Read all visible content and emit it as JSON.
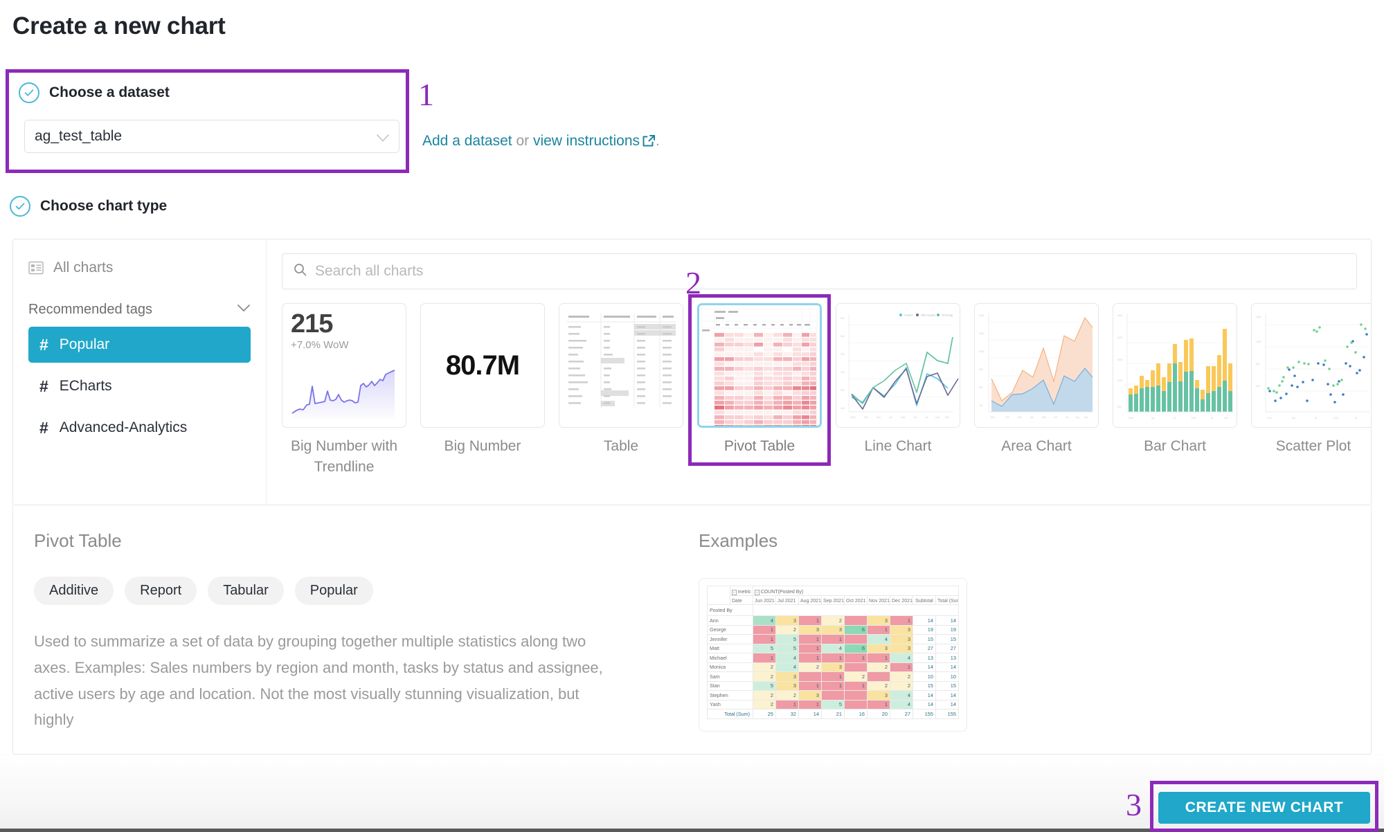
{
  "page_title": "Create a new chart",
  "colors": {
    "accent_teal": "#20A7C9",
    "annotation_purple": "#8C2AB8",
    "link_blue": "#1A85A0"
  },
  "annotations": {
    "one": "1",
    "two": "2",
    "three": "3"
  },
  "step_dataset": {
    "label": "Choose a dataset",
    "selected_value": "ag_test_table",
    "links": {
      "add": "Add a dataset",
      "or": " or ",
      "view": "view instructions",
      "period": "."
    }
  },
  "step_chart_type": {
    "label": "Choose chart type"
  },
  "sidebar": {
    "all_charts": "All charts",
    "recommended_tags": "Recommended tags",
    "tags": [
      {
        "label": "Popular",
        "active": true
      },
      {
        "label": "ECharts",
        "active": false
      },
      {
        "label": "Advanced-Analytics",
        "active": false
      }
    ]
  },
  "search": {
    "placeholder": "Search all charts"
  },
  "thumbnails": [
    {
      "name": "Big Number with Trendline",
      "kind": "bignumber-trend",
      "value": "215",
      "subtitle": "+7.0% WoW",
      "selected": false
    },
    {
      "name": "Big Number",
      "kind": "bignumber",
      "value": "80.7M",
      "selected": false
    },
    {
      "name": "Table",
      "kind": "table",
      "selected": false
    },
    {
      "name": "Pivot Table",
      "kind": "pivot",
      "selected": true
    },
    {
      "name": "Line Chart",
      "kind": "line",
      "selected": false
    },
    {
      "name": "Area Chart",
      "kind": "area",
      "selected": false
    },
    {
      "name": "Bar Chart",
      "kind": "bar",
      "selected": false
    },
    {
      "name": "Scatter Plot",
      "kind": "scatter",
      "selected": false
    }
  ],
  "detail": {
    "title": "Pivot Table",
    "tags": [
      "Additive",
      "Report",
      "Tabular",
      "Popular"
    ],
    "description": "Used to summarize a set of data by grouping together multiple statistics along two axes. Examples: Sales numbers by region and month, tasks by status and assignee, active users by age and location. Not the most visually stunning visualization, but highly",
    "examples_title": "Examples"
  },
  "example_pivot": {
    "metric_label": "metric",
    "count_label": "COUNT(Posted By)",
    "date_label": "Date",
    "row_header": "Posted By",
    "columns": [
      "Jun 2021",
      "Jul 2021",
      "Aug 2021",
      "Sep 2021",
      "Oct 2021",
      "Nov 2021",
      "Dec 2021"
    ],
    "subtotal_label": "Subtotal",
    "total_label": "Total (Sum)",
    "total_row_label": "Total (Sum)",
    "rows": [
      {
        "name": "Ann",
        "values": [
          "4",
          "3",
          "1",
          "2",
          "",
          "3",
          "1"
        ],
        "colors": [
          "g",
          "y",
          "r",
          "ly",
          "r",
          "y",
          "r"
        ],
        "subtotal": "14",
        "total": "14"
      },
      {
        "name": "George",
        "values": [
          "1",
          "2",
          "3",
          "3",
          "6",
          "1",
          "3"
        ],
        "colors": [
          "r",
          "ly",
          "y",
          "y",
          "dg",
          "r",
          "y"
        ],
        "subtotal": "19",
        "total": "19"
      },
      {
        "name": "Jennifer",
        "values": [
          "1",
          "5",
          "1",
          "1",
          "",
          "4",
          "3"
        ],
        "colors": [
          "r",
          "lg",
          "r",
          "r",
          "r",
          "lg",
          "y"
        ],
        "subtotal": "15",
        "total": "15"
      },
      {
        "name": "Matt",
        "values": [
          "5",
          "5",
          "1",
          "4",
          "6",
          "3",
          "3"
        ],
        "colors": [
          "lg",
          "lg",
          "r",
          "lg",
          "dg",
          "y",
          "y"
        ],
        "subtotal": "27",
        "total": "27"
      },
      {
        "name": "Michael",
        "values": [
          "1",
          "4",
          "1",
          "1",
          "1",
          "1",
          "4"
        ],
        "colors": [
          "r",
          "lg",
          "r",
          "r",
          "r",
          "r",
          "lg"
        ],
        "subtotal": "13",
        "total": "13"
      },
      {
        "name": "Monica",
        "values": [
          "2",
          "4",
          "2",
          "3",
          "",
          "2",
          "1"
        ],
        "colors": [
          "ly",
          "lg",
          "ly",
          "y",
          "r",
          "ly",
          "r"
        ],
        "subtotal": "14",
        "total": "14"
      },
      {
        "name": "Sam",
        "values": [
          "2",
          "3",
          "",
          "1",
          "2",
          "",
          "2"
        ],
        "colors": [
          "ly",
          "y",
          "r",
          "r",
          "ly",
          "r",
          "ly"
        ],
        "subtotal": "10",
        "total": "10"
      },
      {
        "name": "Stan",
        "values": [
          "5",
          "3",
          "1",
          "1",
          "1",
          "2",
          "2"
        ],
        "colors": [
          "lg",
          "y",
          "r",
          "r",
          "r",
          "ly",
          "ly"
        ],
        "subtotal": "15",
        "total": "15"
      },
      {
        "name": "Stephen",
        "values": [
          "2",
          "2",
          "3",
          "",
          "",
          "3",
          "4"
        ],
        "colors": [
          "ly",
          "ly",
          "y",
          "r",
          "r",
          "y",
          "lg"
        ],
        "subtotal": "14",
        "total": "14"
      },
      {
        "name": "Yash",
        "values": [
          "2",
          "1",
          "1",
          "5",
          "",
          "1",
          "4"
        ],
        "colors": [
          "ly",
          "r",
          "r",
          "lg",
          "r",
          "r",
          "lg"
        ],
        "subtotal": "14",
        "total": "14"
      }
    ],
    "totals": {
      "values": [
        "25",
        "32",
        "14",
        "21",
        "16",
        "20",
        "27"
      ],
      "subtotal": "155",
      "total": "155"
    }
  },
  "footer": {
    "create_button": "CREATE NEW CHART"
  },
  "chart_data": {
    "type": "table",
    "title": "Pivot Table example — COUNT(Posted By) by Posted By and Date",
    "xlabel": "Date",
    "ylabel": "Posted By",
    "categories": [
      "Jun 2021",
      "Jul 2021",
      "Aug 2021",
      "Sep 2021",
      "Oct 2021",
      "Nov 2021",
      "Dec 2021"
    ],
    "series": [
      {
        "name": "Ann",
        "values": [
          4,
          3,
          1,
          2,
          0,
          3,
          1
        ]
      },
      {
        "name": "George",
        "values": [
          1,
          2,
          3,
          3,
          6,
          1,
          3
        ]
      },
      {
        "name": "Jennifer",
        "values": [
          1,
          5,
          1,
          1,
          0,
          4,
          3
        ]
      },
      {
        "name": "Matt",
        "values": [
          5,
          5,
          1,
          4,
          6,
          3,
          3
        ]
      },
      {
        "name": "Michael",
        "values": [
          1,
          4,
          1,
          1,
          1,
          1,
          4
        ]
      },
      {
        "name": "Monica",
        "values": [
          2,
          4,
          2,
          3,
          0,
          2,
          1
        ]
      },
      {
        "name": "Sam",
        "values": [
          2,
          3,
          0,
          1,
          2,
          0,
          2
        ]
      },
      {
        "name": "Stan",
        "values": [
          5,
          3,
          1,
          1,
          1,
          2,
          2
        ]
      },
      {
        "name": "Stephen",
        "values": [
          2,
          2,
          3,
          0,
          0,
          3,
          4
        ]
      },
      {
        "name": "Yash",
        "values": [
          2,
          1,
          1,
          5,
          0,
          1,
          4
        ]
      }
    ],
    "row_totals": [
      14,
      19,
      15,
      27,
      13,
      14,
      10,
      15,
      14,
      14
    ],
    "column_totals": [
      25,
      32,
      14,
      21,
      16,
      20,
      27
    ],
    "grand_total": 155,
    "legend": "none",
    "grid": true
  }
}
